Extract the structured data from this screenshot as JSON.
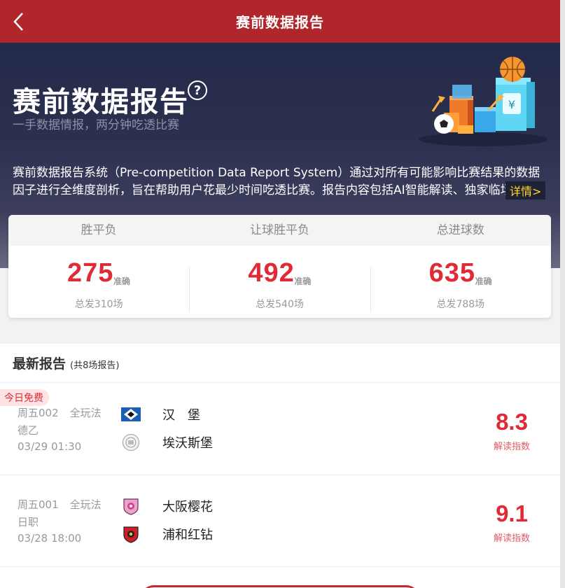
{
  "header": {
    "title": "赛前数据报告",
    "back_icon": "chevron-left-icon"
  },
  "hero": {
    "title": "赛前数据报告",
    "help_glyph": "?",
    "subtitle": "一手数据情报，两分钟吃透比赛",
    "description": "赛前数据报告系统（Pre-competition Data Report System）通过对所有可能影响比赛结果的数据因子进行全维度剖析，旨在帮助用户花最少时间吃透比赛。报告内容包括AI智能解读、独家临场",
    "more_label": "详情>"
  },
  "stats": [
    {
      "label": "胜平负",
      "count": "275",
      "accurate_label": "准确",
      "total": "总发310场"
    },
    {
      "label": "让球胜平负",
      "count": "492",
      "accurate_label": "准确",
      "total": "总发540场"
    },
    {
      "label": "总进球数",
      "count": "635",
      "accurate_label": "准确",
      "total": "总发788场"
    }
  ],
  "reports": {
    "heading": "最新报告",
    "count_text": "(共8场报告)",
    "items": [
      {
        "badge": "今日免费",
        "match_no": "周五002",
        "play": "全玩法",
        "league": "德乙",
        "time": "03/29 01:30",
        "home": "汉　堡",
        "away": "埃沃斯堡",
        "index": "8.3",
        "index_label": "解读指数"
      },
      {
        "badge": "",
        "match_no": "周五001",
        "play": "全玩法",
        "league": "日职",
        "time": "03/28 18:00",
        "home": "大阪樱花",
        "away": "浦和红钻",
        "index": "9.1",
        "index_label": "解读指数"
      }
    ]
  },
  "colors": {
    "brand": "#b0262b",
    "accent_red": "#e02b36",
    "highlight": "#ffd82e"
  }
}
